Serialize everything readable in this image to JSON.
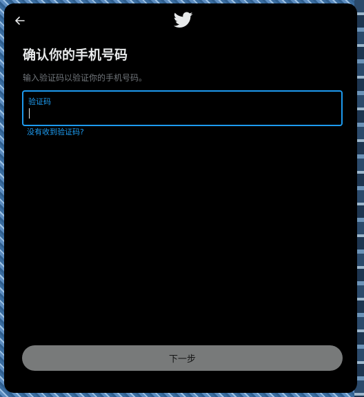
{
  "dialog": {
    "back_icon": "arrow-left-icon",
    "logo_icon": "twitter-bird-icon",
    "title": "确认你的手机号码",
    "subtitle": "输入验证码以验证你的手机号码。",
    "code_field": {
      "label": "验证码",
      "value": ""
    },
    "resend_link": "没有收到验证码?",
    "next_button": "下一步"
  },
  "colors": {
    "background": "#000000",
    "title_text": "#e7e9ea",
    "muted_text": "#71767b",
    "accent": "#1d9bf0",
    "button_disabled": "#787a7a"
  }
}
